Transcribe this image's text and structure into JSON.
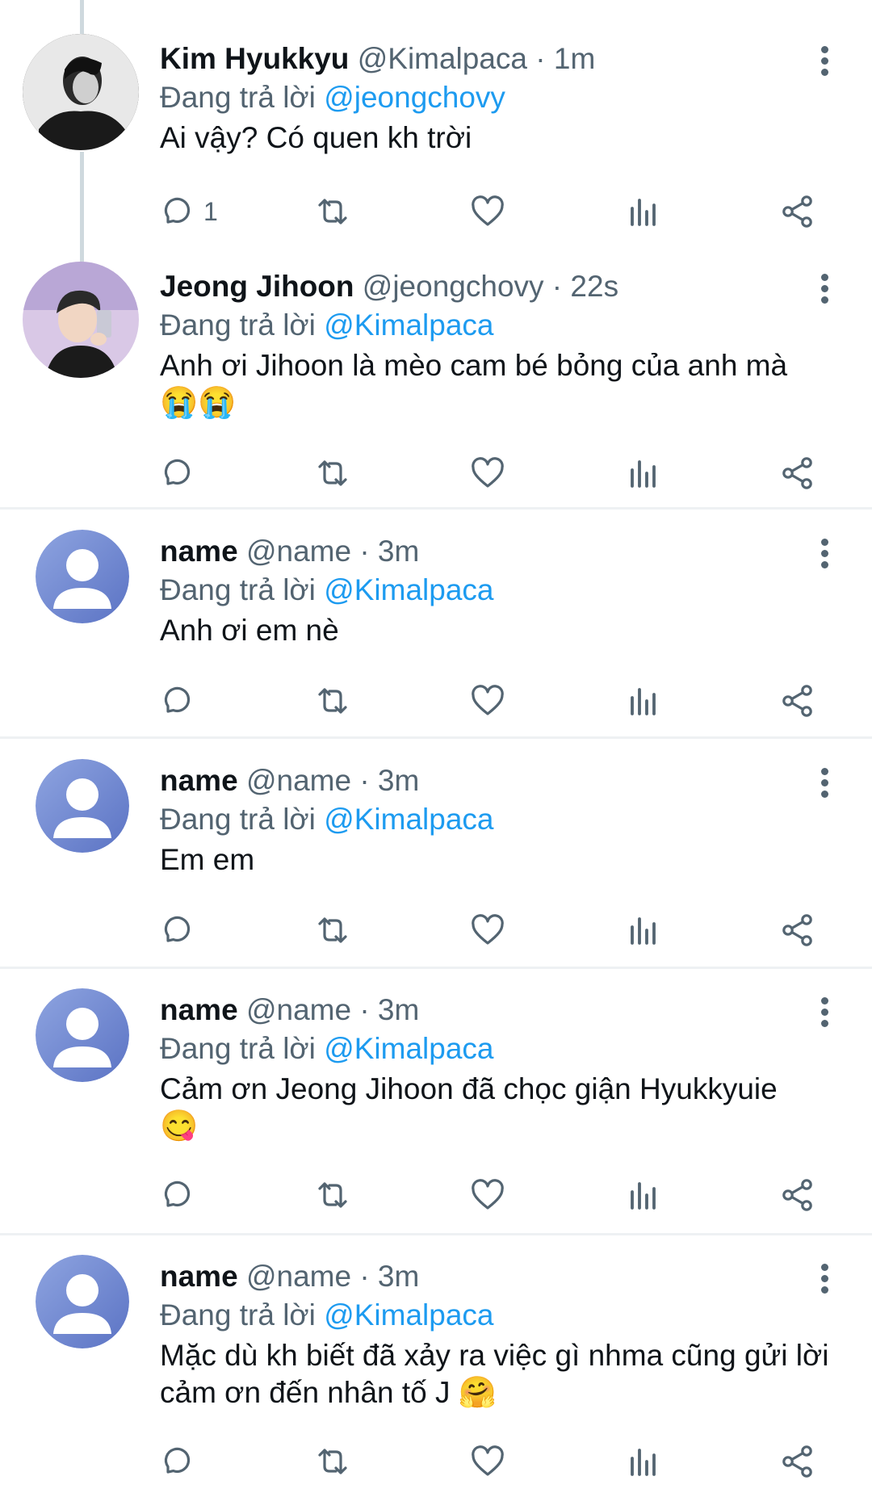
{
  "tweets": [
    {
      "name": "Kim Hyukkyu",
      "meta": "@Kimalpaca · 1m",
      "reply_prefix": "Đang trả lời",
      "reply_to": "@jeongchovy",
      "text": "Ai vậy? Có quen kh trời",
      "emoji": "",
      "reply_count": "1",
      "avatar": "photo-dark"
    },
    {
      "name": "Jeong Jihoon",
      "meta": "@jeongchovy · 22s",
      "reply_prefix": "Đang trả lời",
      "reply_to": "@Kimalpaca",
      "text": "Anh ơi Jihoon là mèo cam bé bỏng của anh mà",
      "emoji": "😭😭",
      "reply_count": "",
      "avatar": "photo-light"
    },
    {
      "name": "name",
      "meta": "@name · 3m",
      "reply_prefix": "Đang trả lời",
      "reply_to": "@Kimalpaca",
      "text": "Anh ơi em nè",
      "emoji": "",
      "reply_count": "",
      "avatar": "default-user-icon"
    },
    {
      "name": "name",
      "meta": "@name · 3m",
      "reply_prefix": "Đang trả lời",
      "reply_to": "@Kimalpaca",
      "text": "Em em",
      "emoji": "",
      "reply_count": "",
      "avatar": "default-user-icon"
    },
    {
      "name": "name",
      "meta": "@name · 3m",
      "reply_prefix": "Đang trả lời",
      "reply_to": "@Kimalpaca",
      "text": "Cảm ơn Jeong Jihoon đã chọc giận Hyukkyuie",
      "emoji": "😋",
      "reply_count": "",
      "avatar": "default-user-icon"
    },
    {
      "name": "name",
      "meta": "@name · 3m",
      "reply_prefix": "Đang trả lời",
      "reply_to": "@Kimalpaca",
      "text": "Mặc dù kh biết đã xảy ra việc gì nhma cũng gửi lời cảm ơn đến nhân tố J",
      "emoji": "🤗",
      "reply_count": "",
      "avatar": "default-user-icon"
    }
  ],
  "colors": {
    "mention": "#1d9bf0",
    "secondary_text": "#536471",
    "primary_text": "#0f1419",
    "divider": "#eef1f3",
    "thread_line": "#cfd9de"
  },
  "icons": [
    "reply-icon",
    "retweet-icon",
    "like-icon",
    "views-icon",
    "share-icon",
    "more-icon"
  ]
}
